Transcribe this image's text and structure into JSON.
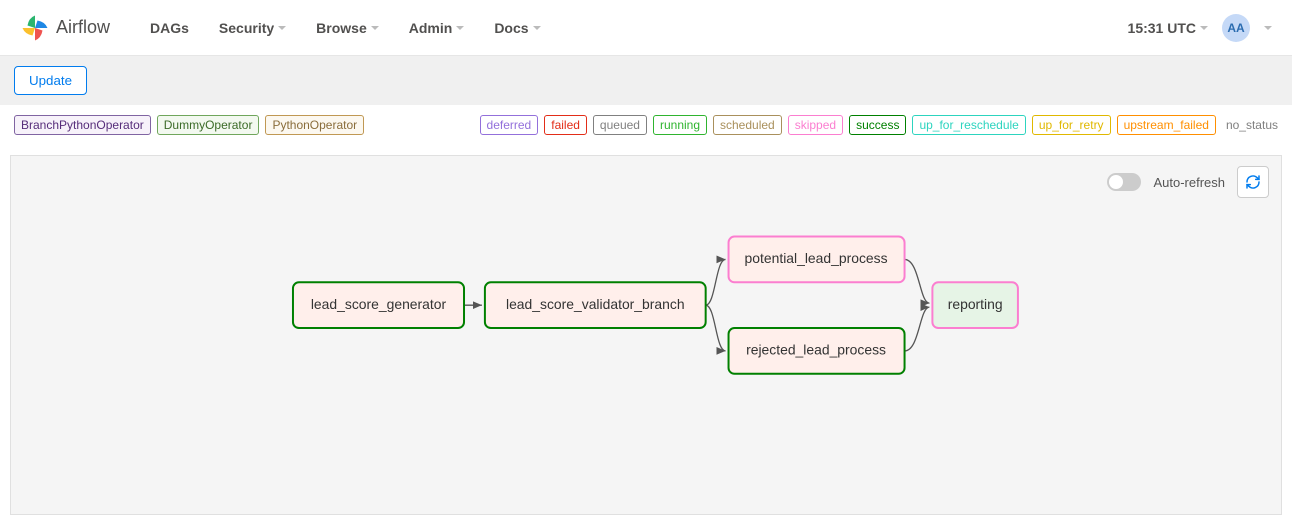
{
  "brand": "Airflow",
  "nav": {
    "dags": "DAGs",
    "security": "Security",
    "browse": "Browse",
    "admin": "Admin",
    "docs": "Docs"
  },
  "clock": "15:31 UTC",
  "user_initials": "AA",
  "update_btn": "Update",
  "operators": {
    "branch": "BranchPythonOperator",
    "dummy": "DummyOperator",
    "python": "PythonOperator"
  },
  "states": {
    "deferred": "deferred",
    "failed": "failed",
    "queued": "queued",
    "running": "running",
    "scheduled": "scheduled",
    "skipped": "skipped",
    "success": "success",
    "up_for_reschedule": "up_for_reschedule",
    "up_for_retry": "up_for_retry",
    "upstream_failed": "upstream_failed",
    "no_status": "no_status"
  },
  "auto_refresh_label": "Auto-refresh",
  "graph": {
    "nodes": {
      "lead_score_generator": "lead_score_generator",
      "lead_score_validator_branch": "lead_score_validator_branch",
      "potential_lead_process": "potential_lead_process",
      "rejected_lead_process": "rejected_lead_process",
      "reporting": "reporting"
    }
  }
}
